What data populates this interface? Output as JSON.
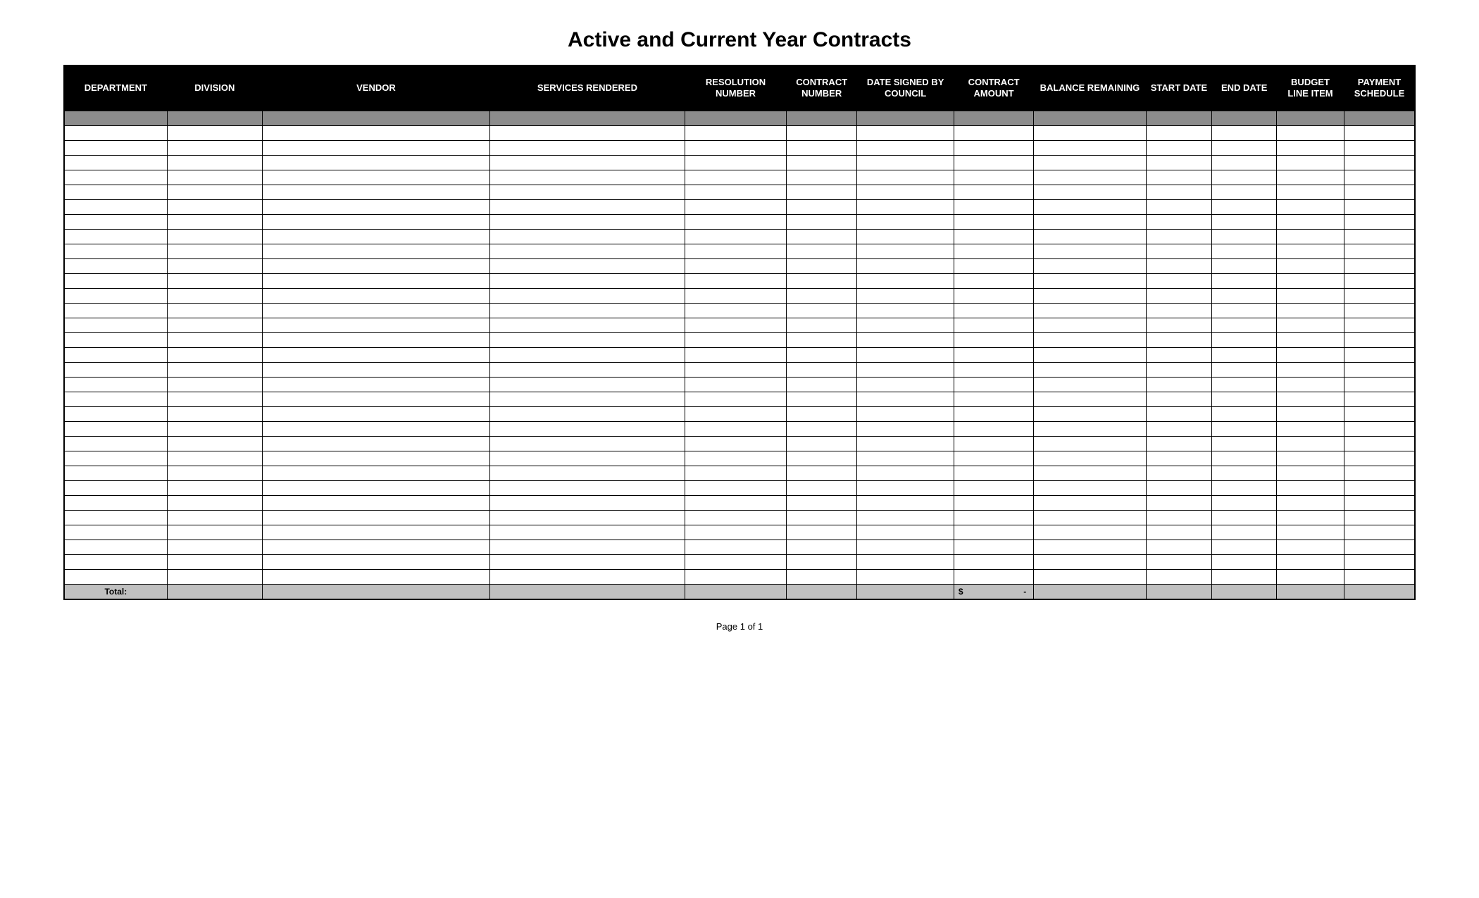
{
  "title": "Active and Current Year Contracts",
  "columns": [
    "DEPARTMENT",
    "DIVISION",
    "VENDOR",
    "SERVICES RENDERED",
    "RESOLUTION NUMBER",
    "CONTRACT NUMBER",
    "DATE SIGNED BY COUNCIL",
    "CONTRACT AMOUNT",
    "BALANCE REMAINING",
    "START DATE",
    "END DATE",
    "BUDGET LINE ITEM",
    "PAYMENT SCHEDULE"
  ],
  "empty_row_count": 31,
  "total": {
    "label": "Total:",
    "contract_amount_symbol": "$",
    "contract_amount_value": "-"
  },
  "footer": "Page 1 of 1"
}
